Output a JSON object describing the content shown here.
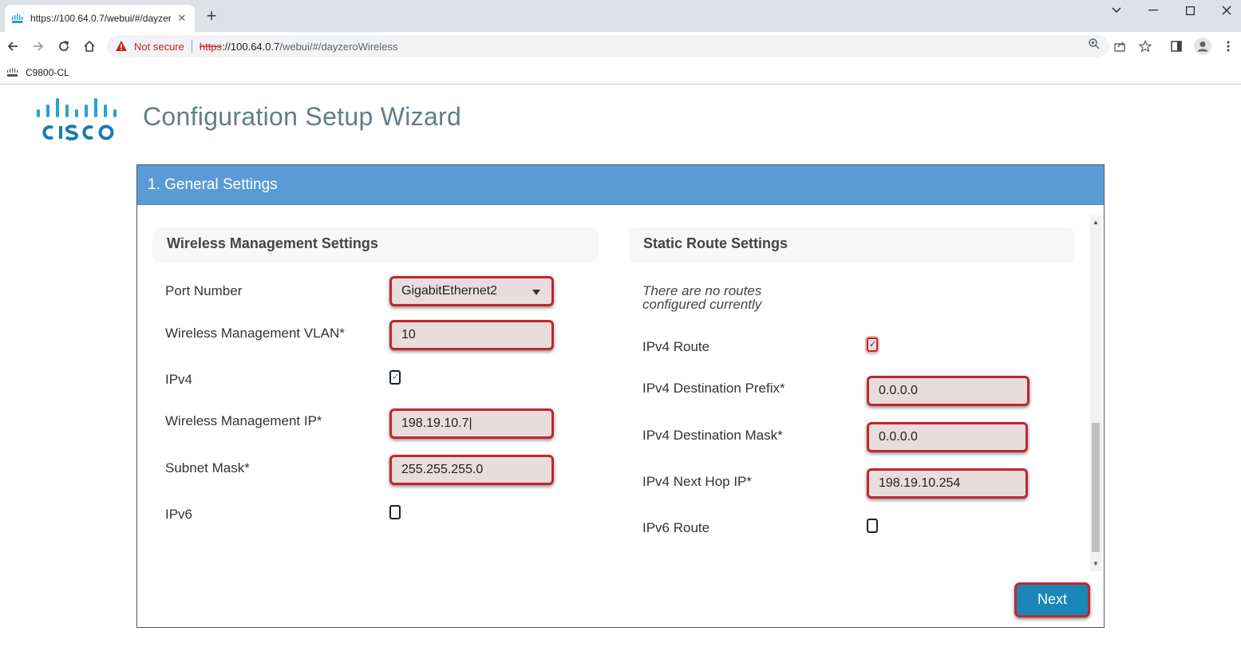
{
  "browser": {
    "tab_title": "https://100.64.0.7/webui/#/dayzeroWireless",
    "new_tab_label": "+",
    "security_label": "Not secure",
    "url_scheme": "https",
    "url_host": "://100.64.0.7",
    "url_path": "/webui/#/dayzeroWireless",
    "bookmark_label": "C9800-CL"
  },
  "page": {
    "title": "Configuration Setup Wizard",
    "step_title": "1. General Settings"
  },
  "wireless": {
    "section_title": "Wireless Management Settings",
    "port_number_label": "Port Number",
    "port_number_value": "GigabitEthernet2",
    "vlan_label": "Wireless Management VLAN*",
    "vlan_value": "10",
    "ipv4_label": "IPv4",
    "ipv4_checked": true,
    "ip_label": "Wireless Management IP*",
    "ip_value": "198.19.10.7|",
    "subnet_label": "Subnet Mask*",
    "subnet_value": "255.255.255.0",
    "ipv6_label": "IPv6",
    "ipv6_checked": false
  },
  "static_route": {
    "section_title": "Static Route Settings",
    "no_routes_line1": "There are no routes",
    "no_routes_line2": "configured currently",
    "ipv4_route_label": "IPv4 Route",
    "ipv4_route_checked": true,
    "dest_prefix_label": "IPv4 Destination Prefix*",
    "dest_prefix_value": "0.0.0.0",
    "dest_mask_label": "IPv4 Destination Mask*",
    "dest_mask_value": "0.0.0.0",
    "next_hop_label": "IPv4 Next Hop IP*",
    "next_hop_value": "198.19.10.254",
    "ipv6_route_label": "IPv6 Route",
    "ipv6_route_checked": false
  },
  "actions": {
    "next_label": "Next"
  },
  "colors": {
    "header_blue": "#5b9bd5",
    "highlight_red": "#c0272d",
    "next_button": "#1b86b8",
    "title_gray": "#607d8b"
  }
}
